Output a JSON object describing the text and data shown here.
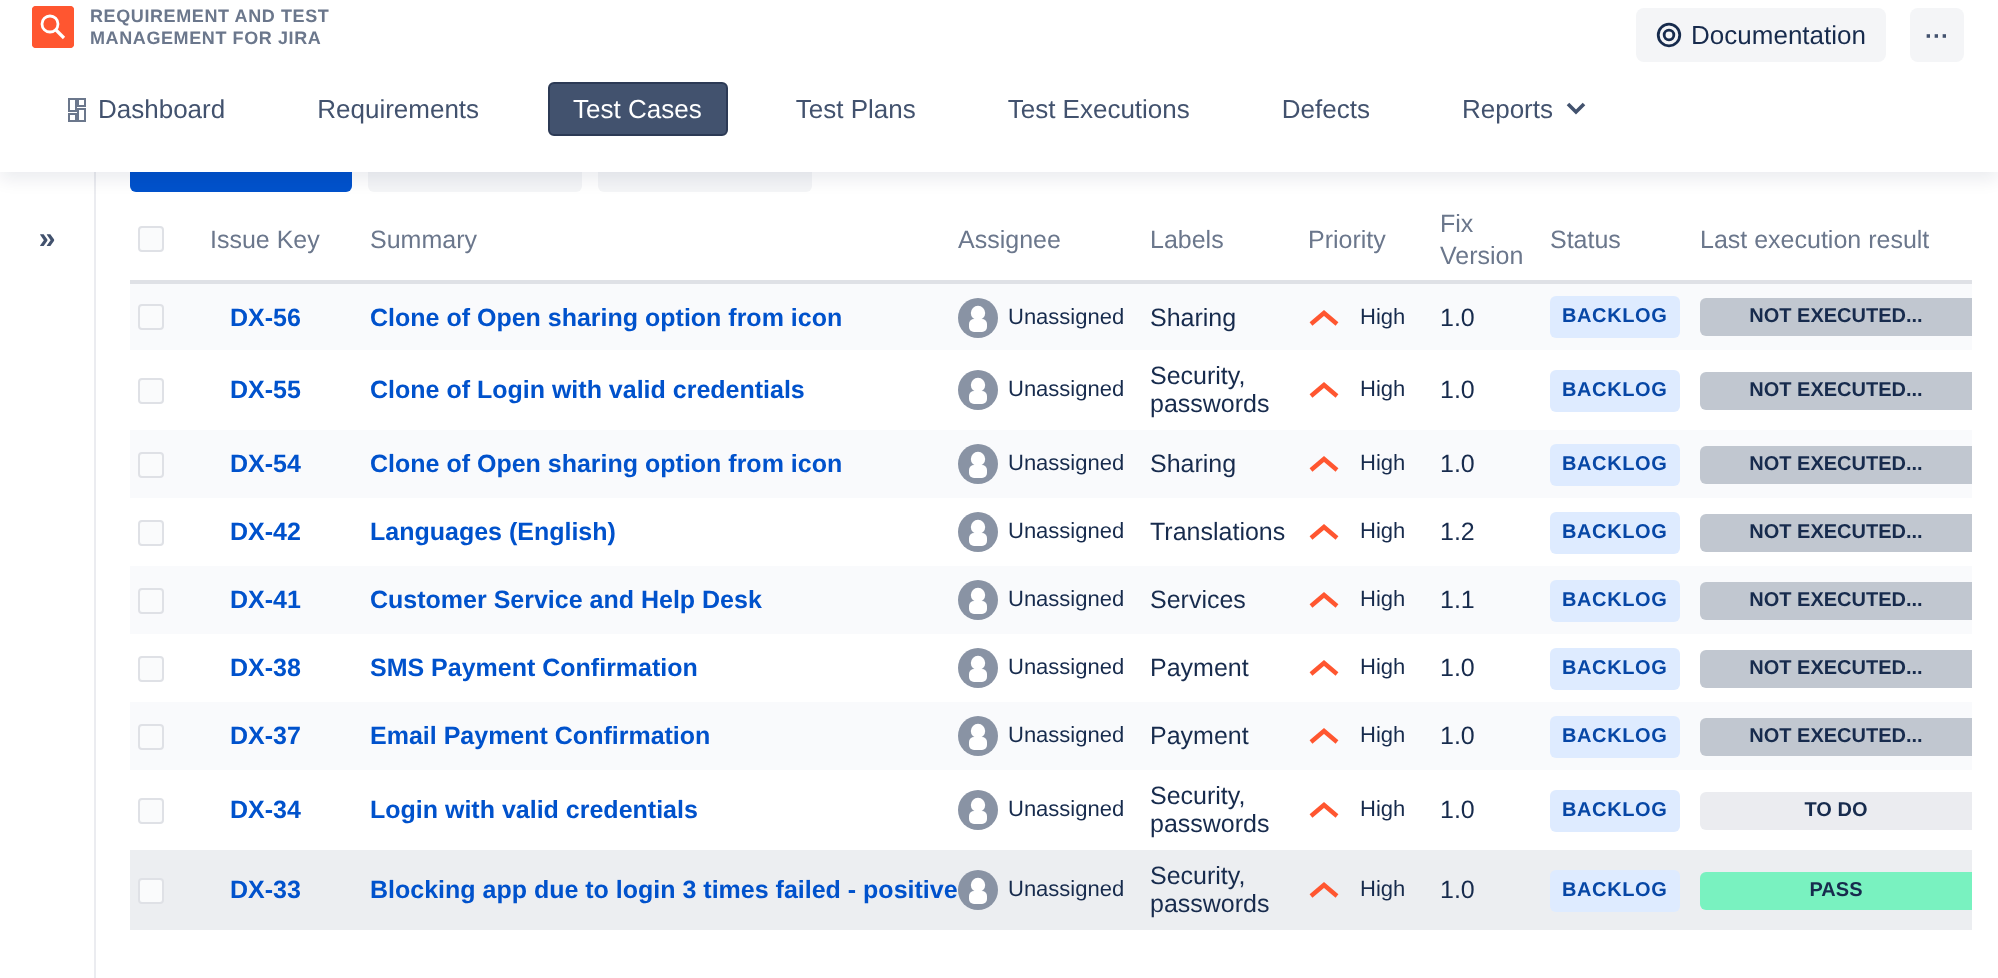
{
  "app": {
    "title_line_1": "REQUIREMENT AND TEST",
    "title_line_2": "MANAGEMENT FOR JIRA"
  },
  "header_actions": {
    "documentation": "Documentation",
    "more": "···"
  },
  "nav": [
    {
      "label": "Dashboard",
      "selected": false,
      "icon": true,
      "dropdown": false
    },
    {
      "label": "Requirements",
      "selected": false,
      "icon": false,
      "dropdown": false
    },
    {
      "label": "Test Cases",
      "selected": true,
      "icon": false,
      "dropdown": false
    },
    {
      "label": "Test Plans",
      "selected": false,
      "icon": false,
      "dropdown": false
    },
    {
      "label": "Test Executions",
      "selected": false,
      "icon": false,
      "dropdown": false
    },
    {
      "label": "Defects",
      "selected": false,
      "icon": false,
      "dropdown": false
    },
    {
      "label": "Reports",
      "selected": false,
      "icon": false,
      "dropdown": true
    }
  ],
  "toolbar": [
    {
      "kind": "primary"
    },
    {
      "kind": "disabled"
    },
    {
      "kind": "disabled"
    }
  ],
  "sidebar": {
    "expand": "»"
  },
  "table": {
    "select_all_checked": false,
    "columns": [
      "Issue Key",
      "Summary",
      "Assignee",
      "Labels",
      "Priority",
      "Fix Version",
      "Status",
      "Last execution result"
    ],
    "rows": [
      {
        "checked": false,
        "hovered": false,
        "key": "DX-56",
        "summary": "Clone of Open sharing option from icon",
        "assignee": "Unassigned",
        "labels": "Sharing",
        "priority": "High",
        "fix_version": "1.0",
        "status": "BACKLOG",
        "result": {
          "kind": "not_executed",
          "text": "NOT EXECUTED..."
        }
      },
      {
        "checked": false,
        "hovered": false,
        "key": "DX-55",
        "summary": "Clone of Login with valid credentials",
        "assignee": "Unassigned",
        "labels": "Security, passwords",
        "priority": "High",
        "fix_version": "1.0",
        "status": "BACKLOG",
        "result": {
          "kind": "not_executed",
          "text": "NOT EXECUTED..."
        }
      },
      {
        "checked": false,
        "hovered": false,
        "key": "DX-54",
        "summary": "Clone of Open sharing option from icon",
        "assignee": "Unassigned",
        "labels": "Sharing",
        "priority": "High",
        "fix_version": "1.0",
        "status": "BACKLOG",
        "result": {
          "kind": "not_executed",
          "text": "NOT EXECUTED..."
        }
      },
      {
        "checked": false,
        "hovered": false,
        "key": "DX-42",
        "summary": "Languages (English)",
        "assignee": "Unassigned",
        "labels": "Translations",
        "priority": "High",
        "fix_version": "1.2",
        "status": "BACKLOG",
        "result": {
          "kind": "not_executed",
          "text": "NOT EXECUTED..."
        }
      },
      {
        "checked": false,
        "hovered": false,
        "key": "DX-41",
        "summary": "Customer Service and Help Desk",
        "assignee": "Unassigned",
        "labels": "Services",
        "priority": "High",
        "fix_version": "1.1",
        "status": "BACKLOG",
        "result": {
          "kind": "not_executed",
          "text": "NOT EXECUTED..."
        }
      },
      {
        "checked": false,
        "hovered": false,
        "key": "DX-38",
        "summary": "SMS Payment Confirmation",
        "assignee": "Unassigned",
        "labels": "Payment",
        "priority": "High",
        "fix_version": "1.0",
        "status": "BACKLOG",
        "result": {
          "kind": "not_executed",
          "text": "NOT EXECUTED..."
        }
      },
      {
        "checked": false,
        "hovered": false,
        "key": "DX-37",
        "summary": "Email Payment Confirmation",
        "assignee": "Unassigned",
        "labels": "Payment",
        "priority": "High",
        "fix_version": "1.0",
        "status": "BACKLOG",
        "result": {
          "kind": "not_executed",
          "text": "NOT EXECUTED..."
        }
      },
      {
        "checked": false,
        "hovered": false,
        "key": "DX-34",
        "summary": "Login with valid credentials",
        "assignee": "Unassigned",
        "labels": "Security, passwords",
        "priority": "High",
        "fix_version": "1.0",
        "status": "BACKLOG",
        "result": {
          "kind": "todo",
          "text": "TO DO"
        }
      },
      {
        "checked": false,
        "hovered": true,
        "key": "DX-33",
        "summary": "Blocking app due to login 3 times failed - positive",
        "assignee": "Unassigned",
        "labels": "Security, passwords",
        "priority": "High",
        "fix_version": "1.0",
        "status": "BACKLOG",
        "result": {
          "kind": "pass",
          "text": "PASS"
        }
      }
    ]
  }
}
